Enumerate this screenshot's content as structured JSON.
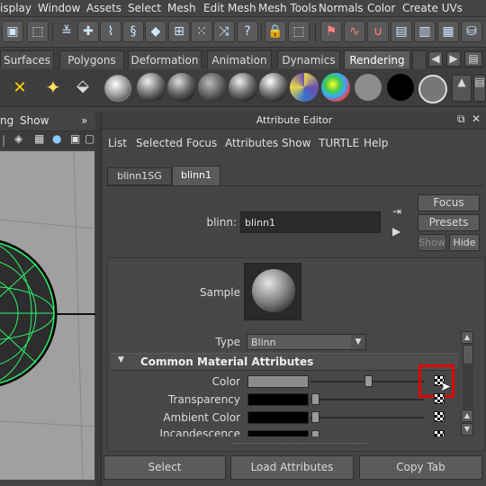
{
  "menubar": {
    "items": [
      "isplay",
      "Window",
      "Assets",
      "Select",
      "Mesh",
      "Edit Mesh",
      "Mesh Tools",
      "Normals",
      "Color",
      "Create UVs"
    ]
  },
  "shelf": {
    "tabs": [
      "Surfaces",
      "Polygons",
      "Deformation",
      "Animation",
      "Dynamics",
      "Rendering"
    ],
    "active_tab": "Rendering"
  },
  "left_panel": {
    "menu": [
      "ng",
      "Show"
    ]
  },
  "attribute_editor": {
    "title": "Attribute Editor",
    "menu": [
      "List",
      "Selected",
      "Focus",
      "Attributes",
      "Show",
      "TURTLE",
      "Help"
    ],
    "tabs": [
      "blinn1SG",
      "blinn1"
    ],
    "active_tab": "blinn1",
    "node_label": "blinn:",
    "node_value": "blinn1",
    "side_buttons": {
      "focus": "Focus",
      "presets": "Presets",
      "show": "Show",
      "hide": "Hide"
    },
    "sample_label": "Sample",
    "type_label": "Type",
    "type_value": "Blinn",
    "section_title": "Common Material Attributes",
    "attributes": [
      {
        "label": "Color"
      },
      {
        "label": "Transparency"
      },
      {
        "label": "Ambient Color"
      },
      {
        "label": "Incandescence"
      }
    ],
    "bottom_buttons": {
      "select": "Select",
      "load": "Load Attributes",
      "copy": "Copy Tab"
    }
  }
}
